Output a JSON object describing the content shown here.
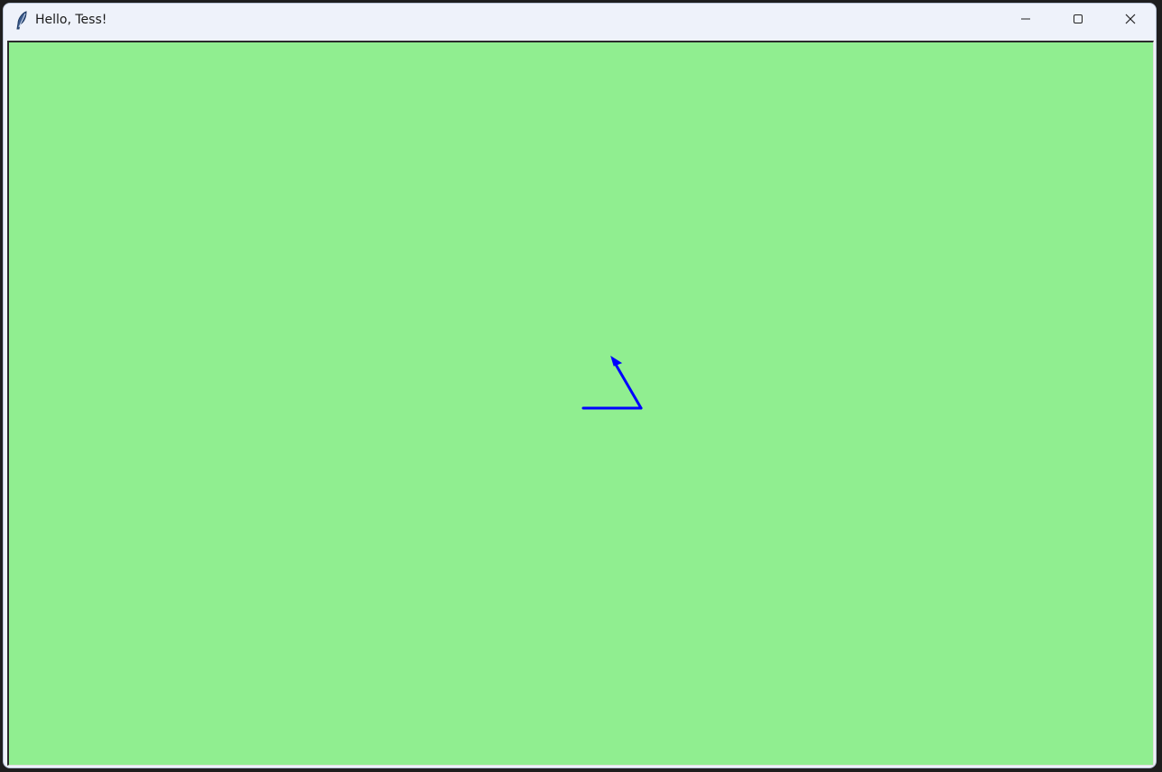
{
  "window": {
    "title": "Hello, Tess!",
    "icon": "feather-icon"
  },
  "titlebar_buttons": {
    "minimize_icon": "minimize-icon",
    "maximize_icon": "maximize-icon",
    "close_icon": "close-icon"
  },
  "canvas": {
    "background_color": "#90ee90",
    "pen_color": "#0000ff"
  }
}
